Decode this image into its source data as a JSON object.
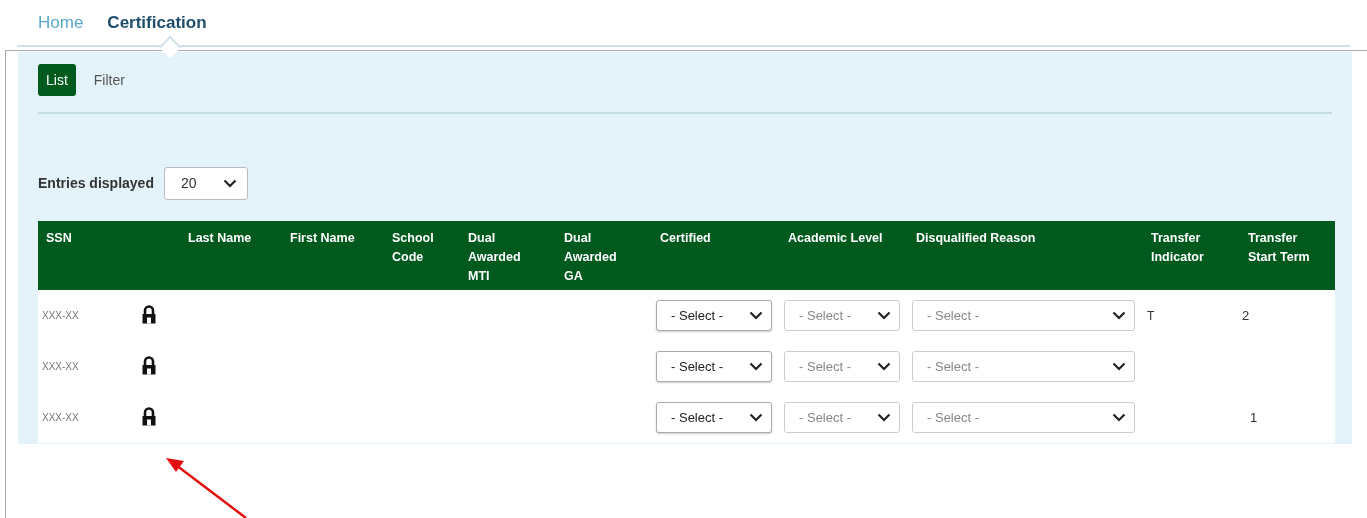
{
  "nav_tabs": [
    {
      "label": "Home",
      "selected": false
    },
    {
      "label": "Certification",
      "selected": true
    }
  ],
  "view_tabs": [
    {
      "label": "List",
      "selected": true
    },
    {
      "label": "Filter",
      "selected": false
    }
  ],
  "entries_displayed": {
    "label": "Entries displayed",
    "value": "20"
  },
  "table": {
    "columns": [
      "SSN",
      "Last Name",
      "First Name",
      "School Code",
      "Dual Awarded MTI",
      "Dual Awarded GA",
      "Certified",
      "Academic Level",
      "Disqualified Reason",
      "Transfer Indicator",
      "Transfer Start Term"
    ],
    "rows": [
      {
        "ssn": "XXX-XX",
        "certified": {
          "value": "- Select -",
          "disabled": false
        },
        "academic_level": {
          "value": "- Select -",
          "disabled": true
        },
        "disqualified_reason": {
          "value": "- Select -",
          "disabled": true
        },
        "transfer_indicator": "T",
        "transfer_start_term": "2"
      },
      {
        "ssn": "XXX-XX",
        "certified": {
          "value": "- Select -",
          "disabled": false
        },
        "academic_level": {
          "value": "- Select -",
          "disabled": true
        },
        "disqualified_reason": {
          "value": "- Select -",
          "disabled": true
        }
      },
      {
        "ssn": "XXX-XX",
        "certified": {
          "value": "- Select -",
          "disabled": false
        },
        "academic_level": {
          "value": "- Select -",
          "disabled": true
        },
        "disqualified_reason": {
          "value": "- Select -",
          "disabled": true
        },
        "transfer_start_term": "1"
      }
    ]
  }
}
